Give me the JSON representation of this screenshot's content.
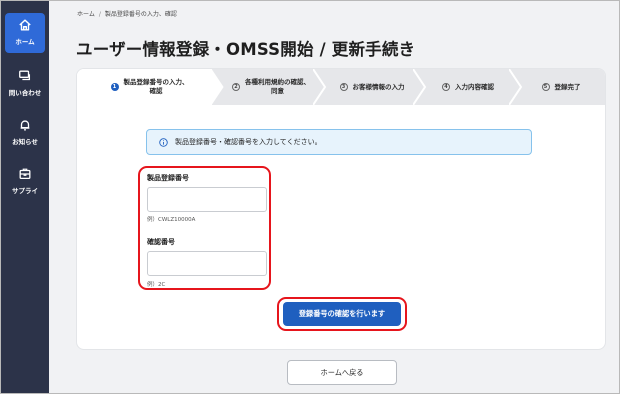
{
  "sidebar": {
    "items": [
      {
        "label": "ホーム",
        "icon": "home-icon",
        "active": true
      },
      {
        "label": "問い合わせ",
        "icon": "chat-icon"
      },
      {
        "label": "お知らせ",
        "icon": "bell-icon"
      },
      {
        "label": "サプライ",
        "icon": "supply-box-icon"
      }
    ]
  },
  "breadcrumb": [
    "ホーム",
    "製品登録番号の入力、確認"
  ],
  "page_title": "ユーザー情報登録・OMSS開始 / 更新手続き",
  "stepper": [
    {
      "num": "1",
      "line1": "製品登録番号の入力、",
      "line2": "確認",
      "active": true
    },
    {
      "num": "2",
      "line1": "各種利用規約の確認、",
      "line2": "同意"
    },
    {
      "num": "3",
      "line1": "お客様情報の入力",
      "line2": ""
    },
    {
      "num": "4",
      "line1": "入力内容確認",
      "line2": ""
    },
    {
      "num": "5",
      "line1": "登録完了",
      "line2": ""
    }
  ],
  "info_message": "製品登録番号・確認番号を入力してください。",
  "form": {
    "serial": {
      "label": "製品登録番号",
      "value": "",
      "hint": "例）CWLZ10000A"
    },
    "confirm": {
      "label": "確認番号",
      "value": "",
      "hint": "例）2C"
    }
  },
  "primary_button": "登録番号の確認を行います",
  "home_button": "ホームへ戻る",
  "colors": {
    "sidebar": "#2c3349",
    "accent": "#1f5fbf",
    "highlight": "#e6151c",
    "info_bg": "#e7f3fc"
  }
}
